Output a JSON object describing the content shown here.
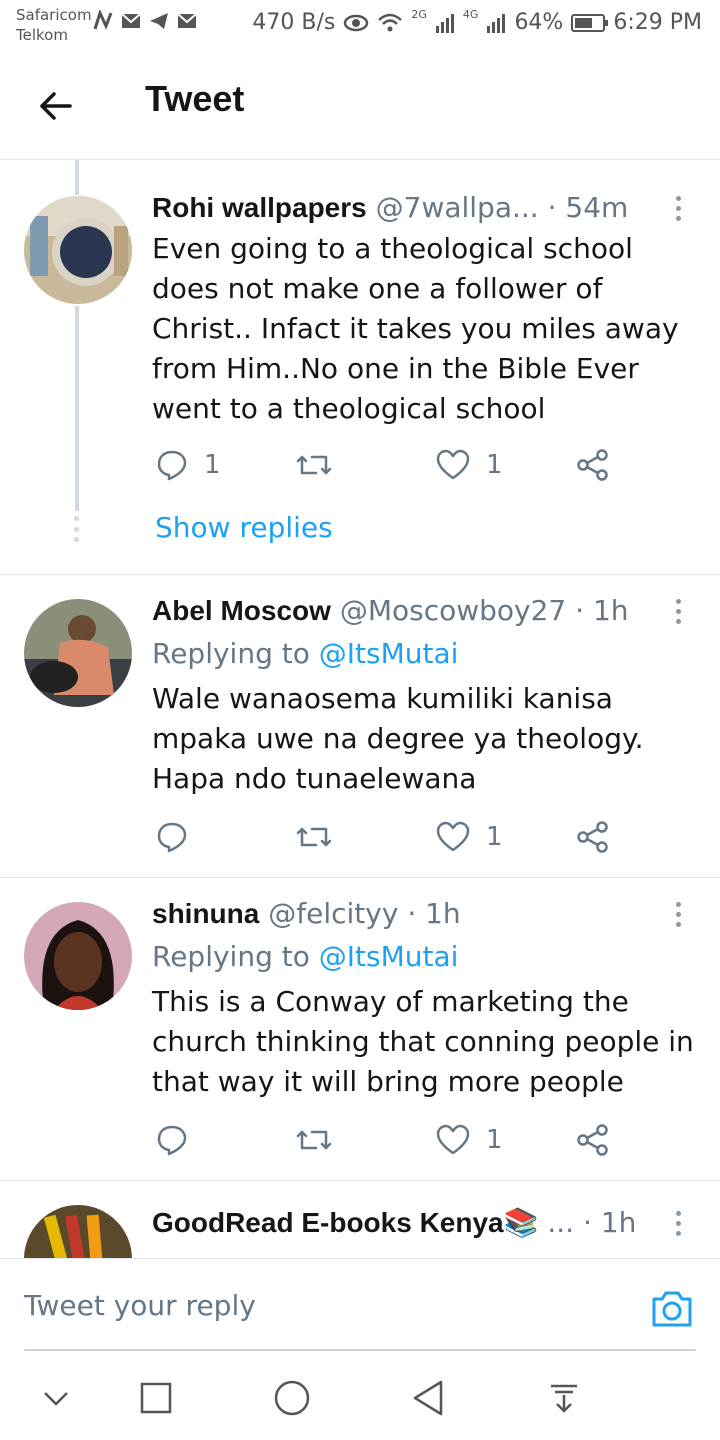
{
  "status_bar": {
    "carrier1": "Safaricom",
    "carrier2": "Telkom",
    "speed": "470 B/s",
    "net1": "2G",
    "net2": "4G",
    "battery": "64%",
    "battery_level": 0.64,
    "time": "6:29 PM"
  },
  "header": {
    "title": "Tweet"
  },
  "tweets": [
    {
      "name": "Rohi wallpapers",
      "handle": "@7wallpa...",
      "time": "· 54m",
      "text": "Even going to a theological school does not make one a follower of Christ.. Infact it takes you miles away from Him..No one in the Bible Ever went to a theological school",
      "replies": "1",
      "retweets": "",
      "likes": "1",
      "show_replies": "Show replies"
    },
    {
      "name": "Abel Moscow",
      "handle": "@Moscowboy27",
      "time": "· 1h",
      "replying_label": "Replying to",
      "replying_to": "@ItsMutai",
      "text": "Wale wanaosema kumiliki kanisa mpaka uwe na degree ya theology. Hapa ndo tunaelewana",
      "replies": "",
      "retweets": "",
      "likes": "1"
    },
    {
      "name": "shinuna",
      "handle": "@felcityy",
      "time": "· 1h",
      "replying_label": "Replying to",
      "replying_to": "@ItsMutai",
      "text": "This is a Conway of marketing the church thinking that conning people in that way it will bring more people",
      "replies": "",
      "retweets": "",
      "likes": "1"
    },
    {
      "name": "GoodRead E-books Kenya",
      "handle": "...",
      "time": "· 1h",
      "emoji": "📚"
    }
  ],
  "composer": {
    "placeholder": "Tweet your reply"
  },
  "icons": {
    "accent": "#1da1f2",
    "text_secondary": "#657786"
  }
}
